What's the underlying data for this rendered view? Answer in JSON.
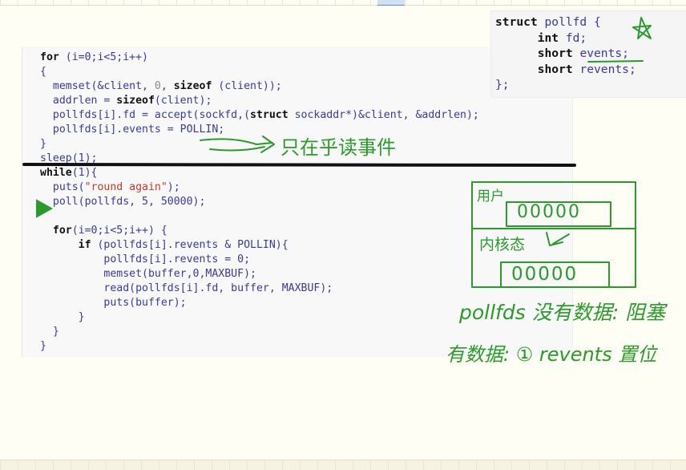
{
  "code": {
    "lines": [
      [
        {
          "t": "for",
          "c": "kw"
        },
        {
          "t": " (i=0;i<5;i++)"
        }
      ],
      [
        {
          "t": "{"
        }
      ],
      [
        {
          "t": "  memset(&client, "
        },
        {
          "t": "0",
          "c": "num"
        },
        {
          "t": ", "
        },
        {
          "t": "sizeof",
          "c": "kw"
        },
        {
          "t": " (client));"
        }
      ],
      [
        {
          "t": "  addrlen = "
        },
        {
          "t": "sizeof",
          "c": "kw"
        },
        {
          "t": "(client);"
        }
      ],
      [
        {
          "t": "  pollfds[i].fd = accept(sockfd,("
        },
        {
          "t": "struct",
          "c": "kw"
        },
        {
          "t": " sockaddr*)&client, &addrlen);"
        }
      ],
      [
        {
          "t": "  pollfds[i].events = POLLIN;"
        }
      ],
      [
        {
          "t": "}"
        }
      ],
      [
        {
          "t": "sleep(1);"
        }
      ],
      [
        {
          "t": "while",
          "c": "kw"
        },
        {
          "t": "(1){"
        }
      ],
      [
        {
          "t": "  puts("
        },
        {
          "t": "\"round again\"",
          "c": "str"
        },
        {
          "t": ");"
        }
      ],
      [
        {
          "t": "  poll(pollfds, 5, 50000);"
        }
      ],
      [
        {
          "t": ""
        }
      ],
      [
        {
          "t": "  "
        },
        {
          "t": "for",
          "c": "kw"
        },
        {
          "t": "(i=0;i<5;i++) {"
        }
      ],
      [
        {
          "t": "      "
        },
        {
          "t": "if",
          "c": "kw"
        },
        {
          "t": " (pollfds[i].revents & POLLIN){"
        }
      ],
      [
        {
          "t": "          pollfds[i].revents = 0;"
        }
      ],
      [
        {
          "t": "          memset(buffer,0,MAXBUF);"
        }
      ],
      [
        {
          "t": "          read(pollfds[i].fd, buffer, MAXBUF);"
        }
      ],
      [
        {
          "t": "          puts(buffer);"
        }
      ],
      [
        {
          "t": "      }"
        }
      ],
      [
        {
          "t": "  }"
        }
      ],
      [
        {
          "t": "}"
        }
      ]
    ]
  },
  "struct": {
    "lines": [
      [
        {
          "t": "struct",
          "c": "kw"
        },
        {
          "t": " pollfd {"
        }
      ],
      [
        {
          "t": "      "
        },
        {
          "t": "int",
          "c": "kw"
        },
        {
          "t": " fd;"
        }
      ],
      [
        {
          "t": "      "
        },
        {
          "t": "short",
          "c": "kw"
        },
        {
          "t": " events;"
        }
      ],
      [
        {
          "t": "      "
        },
        {
          "t": "short",
          "c": "kw"
        },
        {
          "t": " revents;"
        }
      ],
      [
        {
          "t": "};"
        }
      ]
    ]
  },
  "annotations": {
    "only_listen": "只在乎读事件",
    "user_space": "用户",
    "kernel_space": "内核态",
    "user_bits": "00000",
    "kernel_bits": "00000",
    "no_data": "pollfds 没有数据: 阻塞",
    "has_data": "有数据: ① revents 置位"
  },
  "colors": {
    "ink": "#2a9a2a",
    "code_text": "#3a3a9a",
    "keyword": "#111111",
    "string": "#c0392b"
  }
}
